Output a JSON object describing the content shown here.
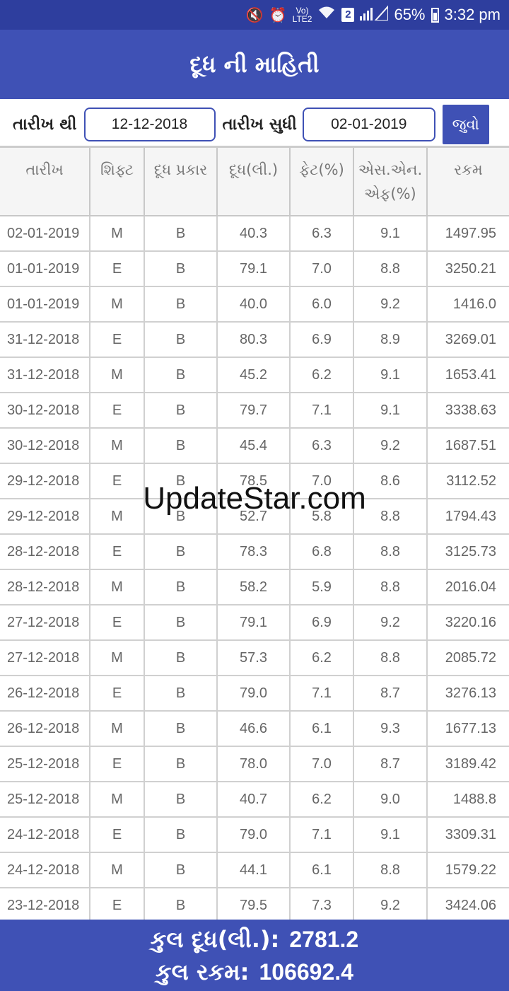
{
  "status_bar": {
    "icons": [
      "mute-icon",
      "alarm-icon",
      "volte-icon",
      "wifi-icon",
      "sim2-icon",
      "signal-icon",
      "battery-icon"
    ],
    "volte_label": "Vo)\nLTE2",
    "sim_badge": "2",
    "battery": "65%",
    "time": "3:32 pm"
  },
  "app_bar": {
    "title": "દૂધ ની માહિતી"
  },
  "filter": {
    "from_label": "તારીખ થી",
    "from_value": "12-12-2018",
    "to_label": "તારીખ સુધી",
    "to_value": "02-01-2019",
    "button_label": "જુવો"
  },
  "table": {
    "headers": [
      "તારીખ",
      "શિફ્ટ",
      "દૂધ પ્રકાર",
      "દૂધ(લી.)",
      "ફેટ(%)",
      "એસ.એન.\nએફ(%)",
      "રકમ"
    ],
    "rows": [
      [
        "02-01-2019",
        "M",
        "B",
        "40.3",
        "6.3",
        "9.1",
        "1497.95"
      ],
      [
        "01-01-2019",
        "E",
        "B",
        "79.1",
        "7.0",
        "8.8",
        "3250.21"
      ],
      [
        "01-01-2019",
        "M",
        "B",
        "40.0",
        "6.0",
        "9.2",
        "1416.0"
      ],
      [
        "31-12-2018",
        "E",
        "B",
        "80.3",
        "6.9",
        "8.9",
        "3269.01"
      ],
      [
        "31-12-2018",
        "M",
        "B",
        "45.2",
        "6.2",
        "9.1",
        "1653.41"
      ],
      [
        "30-12-2018",
        "E",
        "B",
        "79.7",
        "7.1",
        "9.1",
        "3338.63"
      ],
      [
        "30-12-2018",
        "M",
        "B",
        "45.4",
        "6.3",
        "9.2",
        "1687.51"
      ],
      [
        "29-12-2018",
        "E",
        "B",
        "78.5",
        "7.0",
        "8.6",
        "3112.52"
      ],
      [
        "29-12-2018",
        "M",
        "B",
        "52.7",
        "5.8",
        "8.8",
        "1794.43"
      ],
      [
        "28-12-2018",
        "E",
        "B",
        "78.3",
        "6.8",
        "8.8",
        "3125.73"
      ],
      [
        "28-12-2018",
        "M",
        "B",
        "58.2",
        "5.9",
        "8.8",
        "2016.04"
      ],
      [
        "27-12-2018",
        "E",
        "B",
        "79.1",
        "6.9",
        "9.2",
        "3220.16"
      ],
      [
        "27-12-2018",
        "M",
        "B",
        "57.3",
        "6.2",
        "8.8",
        "2085.72"
      ],
      [
        "26-12-2018",
        "E",
        "B",
        "79.0",
        "7.1",
        "8.7",
        "3276.13"
      ],
      [
        "26-12-2018",
        "M",
        "B",
        "46.6",
        "6.1",
        "9.3",
        "1677.13"
      ],
      [
        "25-12-2018",
        "E",
        "B",
        "78.0",
        "7.0",
        "8.7",
        "3189.42"
      ],
      [
        "25-12-2018",
        "M",
        "B",
        "40.7",
        "6.2",
        "9.0",
        "1488.8"
      ],
      [
        "24-12-2018",
        "E",
        "B",
        "79.0",
        "7.1",
        "9.1",
        "3309.31"
      ],
      [
        "24-12-2018",
        "M",
        "B",
        "44.1",
        "6.1",
        "8.8",
        "1579.22"
      ],
      [
        "23-12-2018",
        "E",
        "B",
        "79.5",
        "7.3",
        "9.2",
        "3424.06"
      ]
    ]
  },
  "watermark": "UpdateStar.com",
  "footer": {
    "total_milk_label": "કુલ દૂધ(લી.):",
    "total_milk_value": "2781.2",
    "total_amount_label": "કુલ રકમ:",
    "total_amount_value": "106692.4"
  }
}
